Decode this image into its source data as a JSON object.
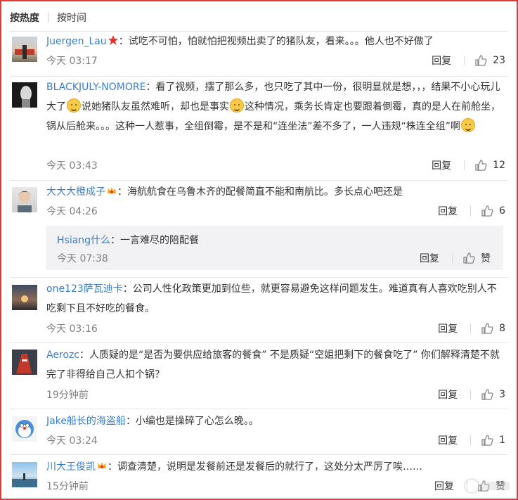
{
  "sort": {
    "hot_label": "按热度",
    "time_label": "按时间"
  },
  "labels": {
    "reply": "回复",
    "like_zero": "赞"
  },
  "comments": [
    {
      "user": "Juergen_Lau",
      "badge": "star",
      "text": "：试吃不可怕，怕就怕把视频出卖了的猪队友，看来。。。他人也不好做了",
      "time": "今天 03:17",
      "likes": "23"
    },
    {
      "user": "BLACKJULY-NOMORE",
      "text_1": "：看了视频，摆了那么多，也只吃了其中一份，很明显就是想，，，结果不小心玩儿大了",
      "text_2": "说她猪队友虽然难听，却也是事实",
      "text_3": "这种情况，乘务长肯定也要跟着倒霉，真的是人在前舱坐，锅从后舱来。。。这种一人惹事，全组倒霉，是不是和“连坐法”差不多了，一人违规“株连全组”啊",
      "time": "今天 03:43",
      "likes": "12"
    },
    {
      "user": "大大大橙成子",
      "badge": "vip",
      "text": "：海航航食在乌鲁木齐的配餐简直不能和南航比。多长点心吧还是",
      "time": "今天 04:26",
      "likes": "6",
      "reply": {
        "user": "Hsiang什么",
        "text": "：一言难尽的陪配餐",
        "time": "今天 07:38",
        "likes": "赞"
      }
    },
    {
      "user": "one123萨瓦迪卡",
      "text": "：公司人性化政策更加到位些，就更容易避免这样问题发生。难道真有人喜欢吃别人不吃剩下且不好吃的餐食。",
      "time": "今天 03:16",
      "likes": "8"
    },
    {
      "user": "Aerozc",
      "text": "：人质疑的是“是否为要供应给旅客的餐食” 不是质疑“空姐把剩下的餐食吃了” 你们解释清楚不就完了非得给自己人扣个锅？",
      "time": "19分钟前",
      "likes": "3"
    },
    {
      "user": "Jake船长的海盗船",
      "text": "：小编也是操碎了心怎么晚。。",
      "time": "今天 03:24",
      "likes": "1"
    },
    {
      "user": "川大王俊凯",
      "badge": "vip",
      "text": "：调查清楚，说明是发餐前还是发餐后的就行了，这处分太严厉了唉……",
      "time": "15分钟前",
      "likes": "赞"
    }
  ],
  "colors": {
    "frame": "#e53935",
    "username": "#3b7dc6",
    "meta": "#808080",
    "subbox": "#f2f2f5"
  }
}
